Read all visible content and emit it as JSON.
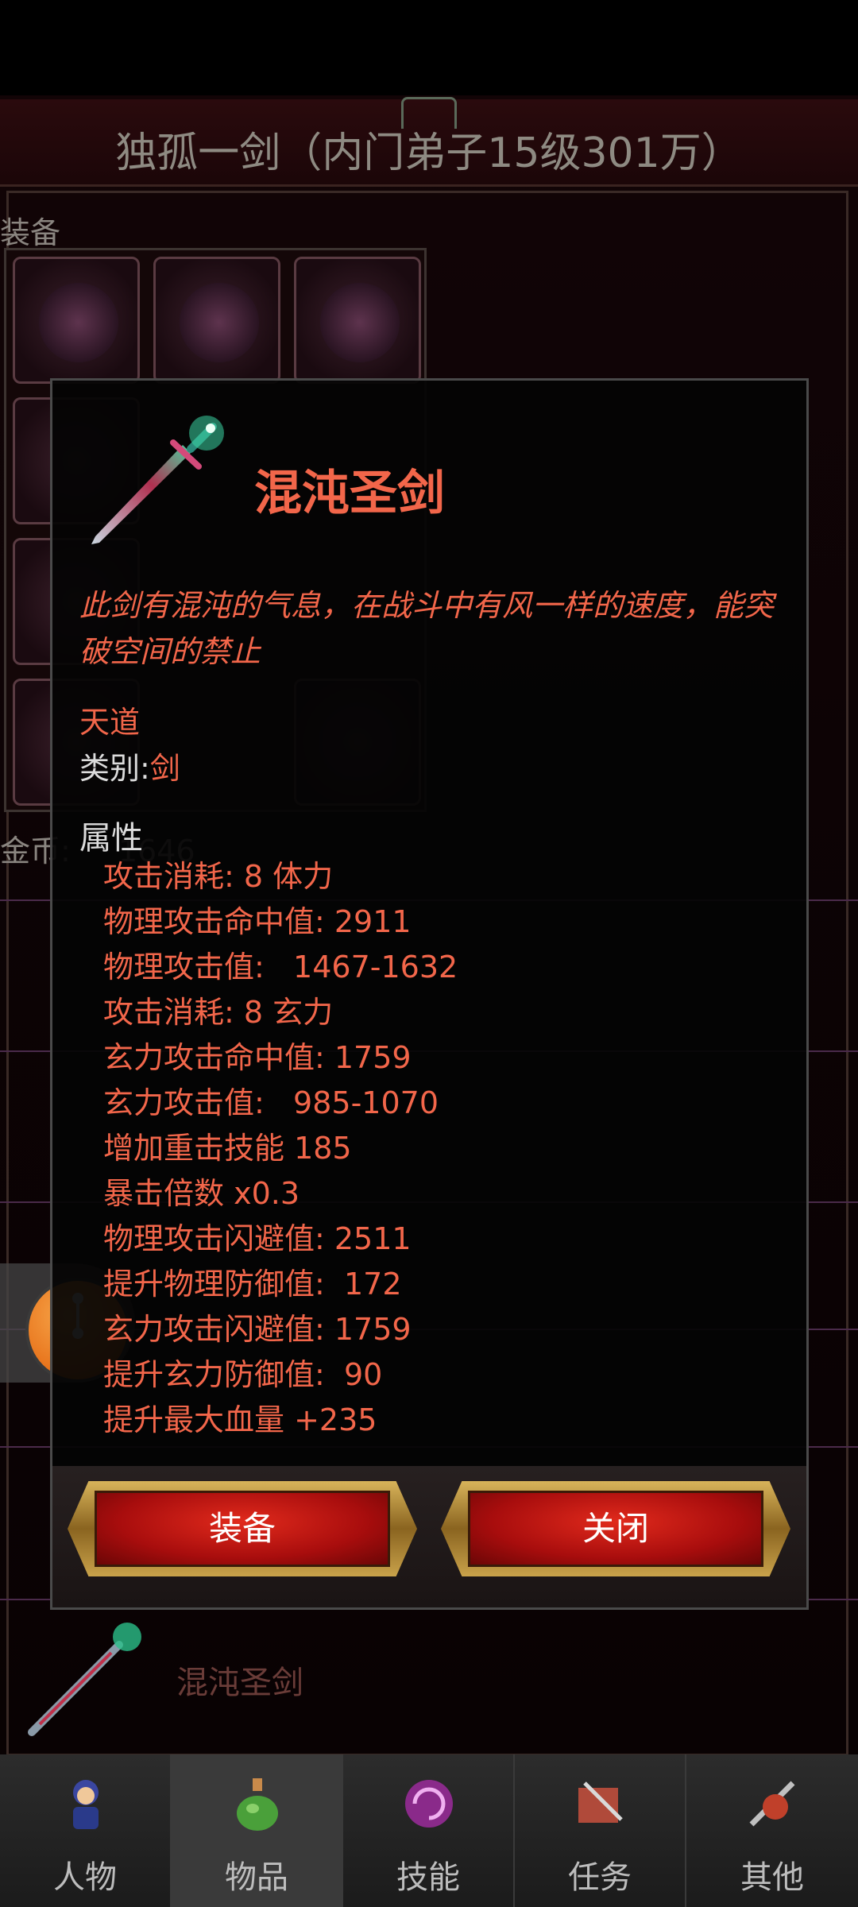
{
  "header": {
    "title": "独孤一剑（内门弟子15级301万）"
  },
  "background": {
    "equipment_label": "装备",
    "gold_label": "金币:",
    "gold_value": "1646",
    "list_item_name": "混沌圣剑"
  },
  "item_modal": {
    "name": "混沌圣剑",
    "description": "此剑有混沌的气息，在战斗中有风一样的速度，能突破空间的禁止",
    "tier": "天道",
    "category_label": "类别:",
    "category_value": "剑",
    "attributes_heading": "属性",
    "attributes": [
      "攻击消耗: 8 体力",
      "物理攻击命中值: 2911",
      "物理攻击值:   1467-1632",
      "攻击消耗: 8 玄力",
      "玄力攻击命中值: 1759",
      "玄力攻击值:   985-1070",
      "增加重击技能 185",
      "暴击倍数 x0.3",
      "物理攻击闪避值: 2511",
      "提升物理防御值:  172",
      "玄力攻击闪避值: 1759",
      "提升玄力防御值:  90",
      "提升最大血量 +235"
    ],
    "equip_button": "装备",
    "close_button": "关闭"
  },
  "bottom_nav": {
    "items": [
      {
        "label": "人物",
        "icon": "character-icon"
      },
      {
        "label": "物品",
        "icon": "items-bag-icon"
      },
      {
        "label": "技能",
        "icon": "skill-orb-icon"
      },
      {
        "label": "任务",
        "icon": "quest-icon"
      },
      {
        "label": "其他",
        "icon": "other-icon"
      }
    ],
    "active_index": 1
  },
  "colors": {
    "accent_red": "#f2664a",
    "button_red": "#c8140f",
    "button_gold": "#c9a24a",
    "float_button_orange": "#e8741c"
  }
}
